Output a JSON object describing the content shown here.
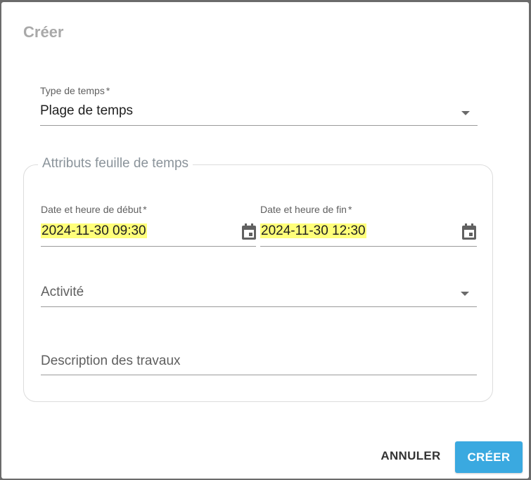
{
  "dialog": {
    "title": "Créer"
  },
  "time_type": {
    "label": "Type de temps",
    "required_mark": "*",
    "value": "Plage de temps"
  },
  "timesheet_attributes": {
    "legend": "Attributs feuille de temps",
    "start": {
      "label": "Date et heure de début",
      "required_mark": "*",
      "value": "2024-11-30 09:30",
      "icon": "calendar-icon"
    },
    "end": {
      "label": "Date et heure de fin",
      "required_mark": "*",
      "value": "2024-11-30 12:30",
      "icon": "calendar-icon"
    },
    "activity": {
      "placeholder": "Activité"
    },
    "description": {
      "placeholder": "Description des travaux"
    }
  },
  "actions": {
    "cancel_label": "ANNULER",
    "create_label": "CRÉER"
  },
  "colors": {
    "primary_button": "#3aa9e0",
    "highlight": "#ffff7a",
    "title": "#a9a9a9"
  }
}
